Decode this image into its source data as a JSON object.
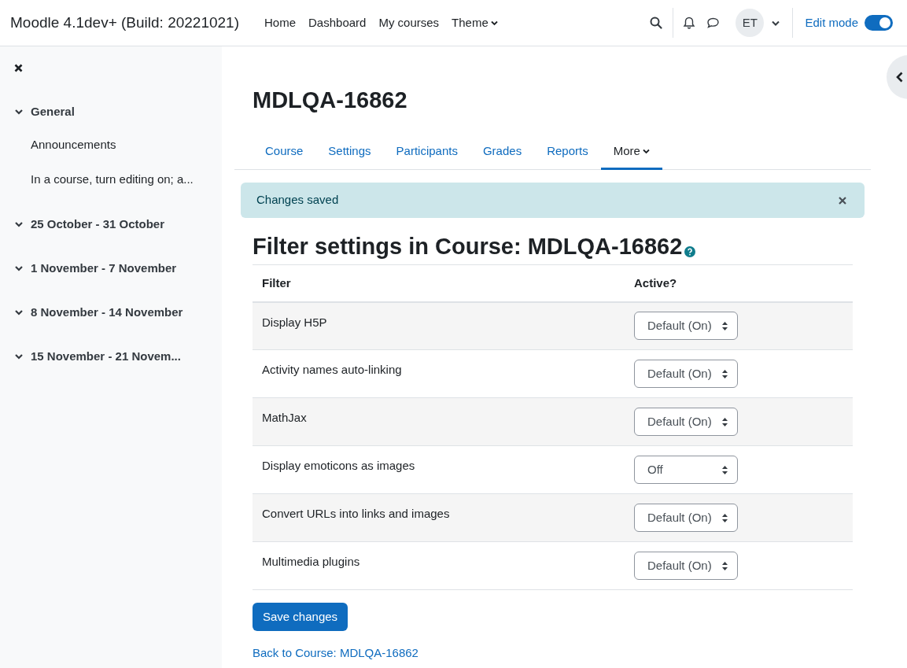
{
  "navbar": {
    "site_name": "Moodle 4.1dev+ (Build: 20221021)",
    "links": [
      {
        "label": "Home",
        "dropdown": false
      },
      {
        "label": "Dashboard",
        "dropdown": false
      },
      {
        "label": "My courses",
        "dropdown": false
      },
      {
        "label": "Theme",
        "dropdown": true
      }
    ],
    "avatar": "ET",
    "edit_mode": {
      "label": "Edit mode",
      "on": true
    }
  },
  "course_index": {
    "sections": [
      {
        "title": "General",
        "items": [
          "Announcements",
          "In a course, turn editing on; a..."
        ]
      },
      {
        "title": "25 October - 31 October"
      },
      {
        "title": "1 November - 7 November"
      },
      {
        "title": "8 November - 14 November"
      },
      {
        "title": "15 November - 21 Novem..."
      }
    ]
  },
  "course_title": "MDLQA-16862",
  "tabs": [
    {
      "label": "Course",
      "selected": false,
      "dropdown": false
    },
    {
      "label": "Settings",
      "selected": false,
      "dropdown": false
    },
    {
      "label": "Participants",
      "selected": false,
      "dropdown": false
    },
    {
      "label": "Grades",
      "selected": false,
      "dropdown": false
    },
    {
      "label": "Reports",
      "selected": false,
      "dropdown": false
    },
    {
      "label": "More",
      "selected": true,
      "dropdown": true
    }
  ],
  "alert": "Changes saved",
  "heading": "Filter settings in Course: MDLQA-16862",
  "table": {
    "columns": [
      "Filter",
      "Active?"
    ],
    "rows": [
      {
        "filter": "Display H5P",
        "active": "Default (On)"
      },
      {
        "filter": "Activity names auto-linking",
        "active": "Default (On)"
      },
      {
        "filter": "MathJax",
        "active": "Default (On)"
      },
      {
        "filter": "Display emoticons as images",
        "active": "Off"
      },
      {
        "filter": "Convert URLs into links and images",
        "active": "Default (On)"
      },
      {
        "filter": "Multimedia plugins",
        "active": "Default (On)"
      }
    ]
  },
  "save_button": "Save changes",
  "back_link": "Back to Course: MDLQA-16862"
}
